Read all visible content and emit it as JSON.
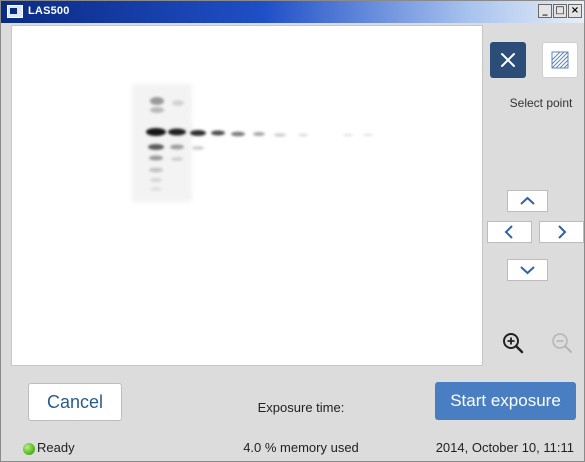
{
  "window": {
    "title": "LAS500",
    "controls": {
      "minimize": "_",
      "maximize": "□",
      "close": "×"
    }
  },
  "sidebar": {
    "close_icon": "x-icon",
    "select_area_icon": "hatch-icon",
    "select_point_label": "Select point",
    "nav": {
      "up_icon": "chevron-up-icon",
      "left_icon": "chevron-left-icon",
      "right_icon": "chevron-right-icon",
      "down_icon": "chevron-down-icon"
    },
    "zoom_in_icon": "zoom-in-icon",
    "zoom_out_icon": "zoom-out-icon"
  },
  "actions": {
    "cancel_label": "Cancel",
    "exposure_time_label": "Exposure time:",
    "start_label": "Start exposure"
  },
  "status": {
    "state": "Ready",
    "memory": "4.0 % memory used",
    "datetime": "2014, October 10, 11:11"
  },
  "colors": {
    "accent": "#4a7ec2",
    "dark_button": "#2b4d77",
    "status_ok": "#5fbf2a",
    "panel_bg": "#dcdcdc"
  }
}
